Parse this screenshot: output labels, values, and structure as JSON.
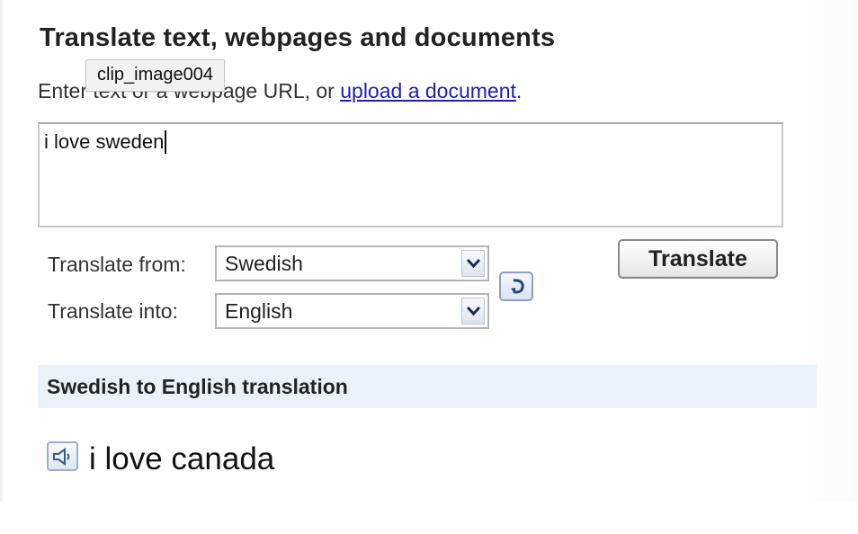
{
  "header": {
    "title": "Translate text, webpages and documents",
    "subtitle_prefix": "Enter text or a webpage URL, or ",
    "upload_link": "upload a document",
    "subtitle_suffix": "."
  },
  "tooltip": {
    "text": "clip_image004"
  },
  "source": {
    "value": "i love sweden"
  },
  "languages": {
    "from_label": "Translate from:",
    "from_value": "Swedish",
    "into_label": "Translate into:",
    "into_value": "English"
  },
  "actions": {
    "translate_label": "Translate",
    "swap_icon": "swap-languages-icon"
  },
  "result": {
    "header": "Swedish to English translation",
    "speaker_icon": "speaker-icon",
    "text": "i love canada"
  },
  "colors": {
    "link": "#2020a8",
    "result_header_bg": "#ebf1f9",
    "button_border": "#8b8b8b"
  }
}
